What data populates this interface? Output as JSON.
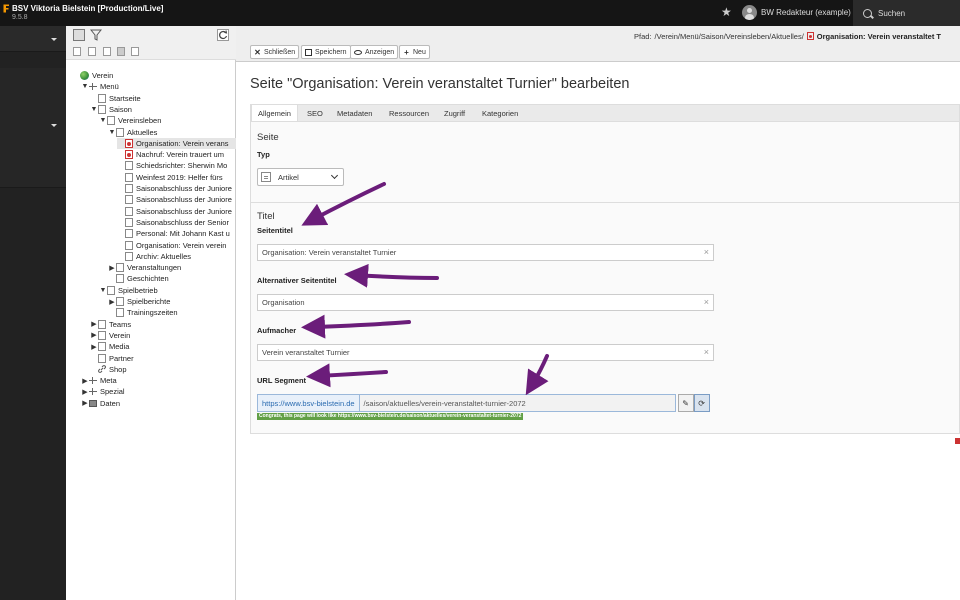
{
  "topbar": {
    "site_title": "BSV Viktoria Bielstein [Production/Live]",
    "version": "9.5.8",
    "user_name": "BW Redakteur (example)",
    "search_label": "Suchen"
  },
  "tree": {
    "nodes": [
      {
        "label": "Verein",
        "icon": "globe-icon",
        "indent": 0,
        "arrow": ""
      },
      {
        "label": "Menü",
        "icon": "menu-separator-icon",
        "indent": 1,
        "arrow": "▼"
      },
      {
        "label": "Startseite",
        "icon": "page-icon",
        "indent": 2,
        "arrow": ""
      },
      {
        "label": "Saison",
        "icon": "page-icon",
        "indent": 2,
        "arrow": "▼"
      },
      {
        "label": "Vereinsleben",
        "icon": "page-icon",
        "indent": 3,
        "arrow": "▼"
      },
      {
        "label": "Aktuelles",
        "icon": "page-icon",
        "indent": 4,
        "arrow": "▼"
      },
      {
        "label": "Organisation: Verein verans",
        "icon": "page-red-icon",
        "indent": 5,
        "arrow": ""
      },
      {
        "label": "Nachruf: Verein trauert um",
        "icon": "page-red-icon",
        "indent": 5,
        "arrow": ""
      },
      {
        "label": "Schiedsrichter: Sherwin Mo",
        "icon": "page-icon",
        "indent": 5,
        "arrow": ""
      },
      {
        "label": "Weinfest 2019: Helfer fürs",
        "icon": "page-icon",
        "indent": 5,
        "arrow": ""
      },
      {
        "label": "Saisonabschluss der Juniore",
        "icon": "page-icon",
        "indent": 5,
        "arrow": ""
      },
      {
        "label": "Saisonabschluss der Juniore",
        "icon": "page-icon",
        "indent": 5,
        "arrow": ""
      },
      {
        "label": "Saisonabschluss der Juniore",
        "icon": "page-icon",
        "indent": 5,
        "arrow": ""
      },
      {
        "label": "Saisonabschluss der Senior",
        "icon": "page-icon",
        "indent": 5,
        "arrow": ""
      },
      {
        "label": "Personal: Mit Johann Kast u",
        "icon": "page-icon",
        "indent": 5,
        "arrow": ""
      },
      {
        "label": "Organisation: Verein verein",
        "icon": "page-icon",
        "indent": 5,
        "arrow": ""
      },
      {
        "label": "Archiv: Aktuelles",
        "icon": "page-icon",
        "indent": 5,
        "arrow": ""
      },
      {
        "label": "Veranstaltungen",
        "icon": "page-icon",
        "indent": 4,
        "arrow": "▶"
      },
      {
        "label": "Geschichten",
        "icon": "page-icon",
        "indent": 4,
        "arrow": ""
      },
      {
        "label": "Spielbetrieb",
        "icon": "page-icon",
        "indent": 3,
        "arrow": "▼"
      },
      {
        "label": "Spielberichte",
        "icon": "page-icon",
        "indent": 4,
        "arrow": "▶"
      },
      {
        "label": "Trainingszeiten",
        "icon": "page-icon",
        "indent": 4,
        "arrow": ""
      },
      {
        "label": "Teams",
        "icon": "page-icon",
        "indent": 2,
        "arrow": "▶"
      },
      {
        "label": "Verein",
        "icon": "page-icon",
        "indent": 2,
        "arrow": "▶"
      },
      {
        "label": "Media",
        "icon": "page-icon",
        "indent": 2,
        "arrow": "▶"
      },
      {
        "label": "Partner",
        "icon": "page-icon",
        "indent": 2,
        "arrow": ""
      },
      {
        "label": "Shop",
        "icon": "link-icon",
        "indent": 2,
        "arrow": ""
      },
      {
        "label": "Meta",
        "icon": "menu-separator-icon",
        "indent": 1,
        "arrow": "▶"
      },
      {
        "label": "Spezial",
        "icon": "menu-separator-icon",
        "indent": 1,
        "arrow": "▶"
      },
      {
        "label": "Daten",
        "icon": "folder-icon",
        "indent": 1,
        "arrow": "▶"
      }
    ]
  },
  "docheader": {
    "buttons": {
      "close": "Schließen",
      "save": "Speichern",
      "view": "Anzeigen",
      "new": "Neu"
    },
    "path_label": "Pfad:",
    "path_value": "/Verein/Menü/Saison/Vereinsleben/Aktuelles/",
    "path_title": "Organisation: Verein veranstaltet T"
  },
  "content": {
    "heading": "Seite \"Organisation: Verein veranstaltet Turnier\" bearbeiten",
    "tabs": [
      "Allgemein",
      "SEO",
      "Metadaten",
      "Ressourcen",
      "Zugriff",
      "Kategorien"
    ],
    "section_page": "Seite",
    "type_label": "Typ",
    "type_value": "Artikel",
    "section_title": "Titel",
    "page_title_label": "Seitentitel",
    "page_title_value": "Organisation: Verein veranstaltet Turnier",
    "alt_title_label": "Alternativer Seitentitel",
    "alt_title_value": "Organisation",
    "kicker_label": "Aufmacher",
    "kicker_value": "Verein veranstaltet Turnier",
    "url_label": "URL Segment",
    "url_prefix": "https://www.bsv-bielstein.de",
    "url_value": "/saison/aktuelles/verein-veranstaltet-turnier-2072",
    "url_hint": "Congrats, this page will look like https://www.bsv-bielstein.de/saison/aktuelles/verein-veranstaltet-turnier-2072"
  },
  "colors": {
    "topbar": "#151515",
    "annotation_arrow": "#6b1d7a",
    "hint_green": "#62a046",
    "url_blue": "#2a6bb0"
  }
}
